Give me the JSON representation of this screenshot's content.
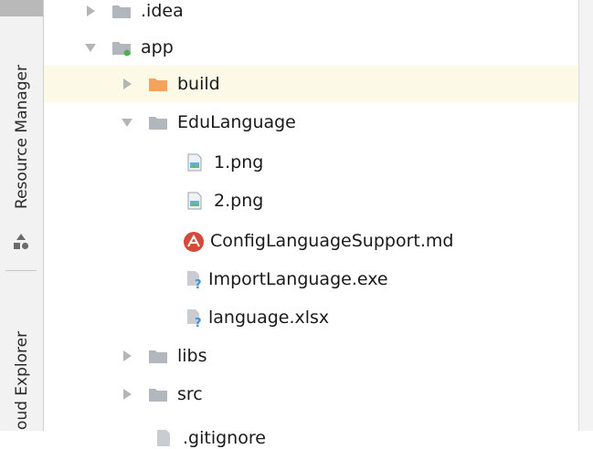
{
  "sidebar": {
    "resource_manager_label": "Resource Manager",
    "cloud_explorer_label": "oud Explorer"
  },
  "tree": {
    "items": [
      {
        "label": ".idea",
        "icon": "folder-icon",
        "expanded": false
      },
      {
        "label": "app",
        "icon": "module-folder-icon",
        "expanded": true
      },
      {
        "label": "build",
        "icon": "folder-orange-icon",
        "expanded": false,
        "selected": true
      },
      {
        "label": "EduLanguage",
        "icon": "folder-icon",
        "expanded": true
      },
      {
        "label": "1.png",
        "icon": "image-file-icon"
      },
      {
        "label": "2.png",
        "icon": "image-file-icon"
      },
      {
        "label": "ConfigLanguageSupport.md",
        "icon": "markdown-file-icon"
      },
      {
        "label": "ImportLanguage.exe",
        "icon": "unknown-file-icon"
      },
      {
        "label": "language.xlsx",
        "icon": "unknown-file-icon"
      },
      {
        "label": "libs",
        "icon": "folder-icon",
        "expanded": false
      },
      {
        "label": "src",
        "icon": "folder-icon",
        "expanded": false
      },
      {
        "label": ".gitignore",
        "icon": "text-file-icon"
      }
    ]
  },
  "colors": {
    "selected_row": "#fcfae6",
    "folder_gray": "#b2b7bd",
    "folder_orange": "#f5a35a",
    "markdown_red": "#d44a3a",
    "unknown_blue": "#3d8fd6"
  }
}
